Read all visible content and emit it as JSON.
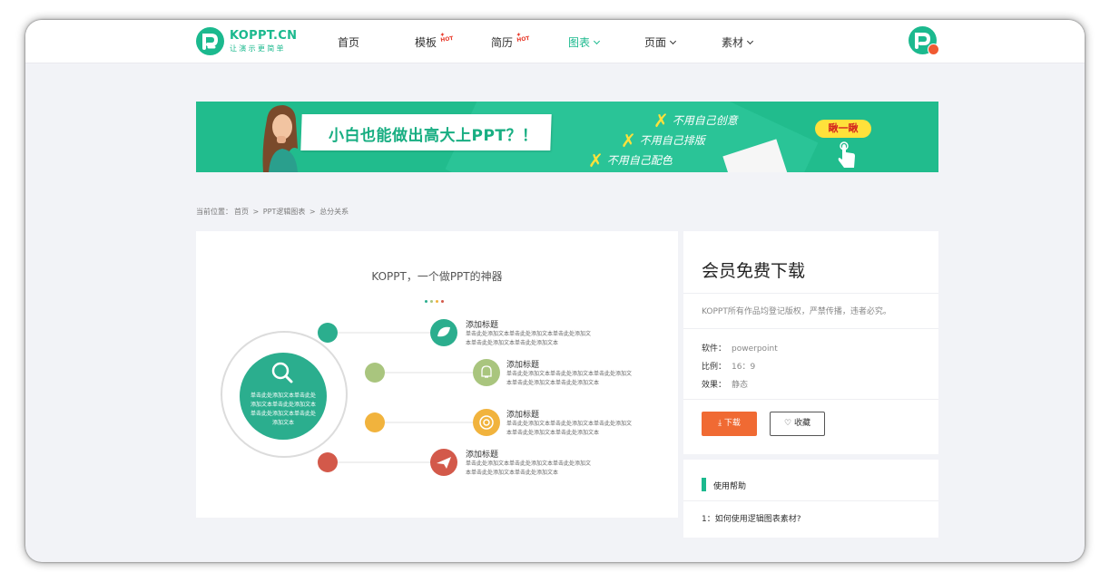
{
  "site": {
    "name": "KOPPT.CN",
    "slogan": "让演示更简单"
  },
  "nav": {
    "items": [
      {
        "label": "首页"
      },
      {
        "label": "模板",
        "badge": "HOT"
      },
      {
        "label": "简历",
        "badge": "HOT"
      },
      {
        "label": "图表",
        "active": true
      },
      {
        "label": "页面"
      },
      {
        "label": "素材"
      }
    ]
  },
  "banner": {
    "slogan": "小白也能做出高大上PPT？！",
    "bullets": [
      "不用自己创意",
      "不用自己排版",
      "不用自己配色"
    ],
    "bullet_mark": "✗",
    "cta": "瞅一瞅",
    "colors": {
      "bg": "#21bc8d",
      "accent": "#ffe13b"
    }
  },
  "breadcrumb": {
    "prefix": "当前位置：",
    "items": [
      "首页",
      "PPT逻辑图表",
      "总分关系"
    ],
    "separator": ">"
  },
  "preview": {
    "title": "KOPPT，一个做PPT的神器",
    "center_text": "单击此处添加文本单击此处添加文本单击此处添加文本单击此处添加文本单击此处添加文本",
    "nodes": [
      {
        "title": "添加标题",
        "text": "单击此处添加文本单击此处添加文本单击此处添加文本单击此处添加文本单击此处添加文本",
        "icon": "leaf-icon",
        "color": "#2bae8e"
      },
      {
        "title": "添加标题",
        "text": "单击此处添加文本单击此处添加文本单击此处添加文本单击此处添加文本单击此处添加文本",
        "icon": "bell-icon",
        "color": "#a9c57e"
      },
      {
        "title": "添加标题",
        "text": "单击此处添加文本单击此处添加文本单击此处添加文本单击此处添加文本单击此处添加文本",
        "icon": "target-icon",
        "color": "#f1b33d"
      },
      {
        "title": "添加标题",
        "text": "单击此处添加文本单击此处添加文本单击此处添加文本单击此处添加文本单击此处添加文本",
        "icon": "paper-plane-icon",
        "color": "#d3594a"
      }
    ]
  },
  "download_card": {
    "title": "会员免费下载",
    "notice": "KOPPT所有作品均登记版权，严禁传播，违者必究。",
    "meta": [
      {
        "key": "软件：",
        "value": "powerpoint"
      },
      {
        "key": "比例：",
        "value": "16：9"
      },
      {
        "key": "效果：",
        "value": "静态"
      }
    ],
    "download_label": "下载",
    "favorite_label": "收藏",
    "colors": {
      "download": "#f06a33"
    }
  },
  "help": {
    "title": "使用帮助",
    "question": "1：如何使用逻辑图表素材?"
  }
}
